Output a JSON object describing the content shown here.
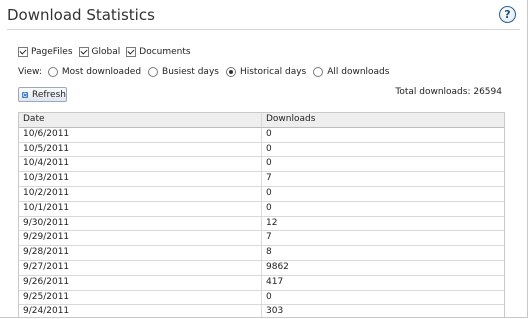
{
  "header": {
    "title": "Download Statistics",
    "help_glyph": "?"
  },
  "filters": [
    {
      "label": "PageFiles",
      "checked": true
    },
    {
      "label": "Global",
      "checked": true
    },
    {
      "label": "Documents",
      "checked": true
    }
  ],
  "view": {
    "label": "View:",
    "options": [
      {
        "label": "Most downloaded",
        "selected": false
      },
      {
        "label": "Busiest days",
        "selected": false
      },
      {
        "label": "Historical days",
        "selected": true
      },
      {
        "label": "All downloads",
        "selected": false
      }
    ]
  },
  "toolbar": {
    "refresh_label": "Refresh",
    "refresh_icon": "refresh-icon"
  },
  "summary": {
    "total_text": "Total downloads: 26594"
  },
  "table": {
    "columns": [
      "Date",
      "Downloads"
    ],
    "rows": [
      {
        "date": "10/6/2011",
        "downloads": "0"
      },
      {
        "date": "10/5/2011",
        "downloads": "0"
      },
      {
        "date": "10/4/2011",
        "downloads": "0"
      },
      {
        "date": "10/3/2011",
        "downloads": "7"
      },
      {
        "date": "10/2/2011",
        "downloads": "0"
      },
      {
        "date": "10/1/2011",
        "downloads": "0"
      },
      {
        "date": "9/30/2011",
        "downloads": "12"
      },
      {
        "date": "9/29/2011",
        "downloads": "7"
      },
      {
        "date": "9/28/2011",
        "downloads": "8"
      },
      {
        "date": "9/27/2011",
        "downloads": "9862"
      },
      {
        "date": "9/26/2011",
        "downloads": "417"
      },
      {
        "date": "9/25/2011",
        "downloads": "0"
      },
      {
        "date": "9/24/2011",
        "downloads": "303"
      }
    ]
  }
}
